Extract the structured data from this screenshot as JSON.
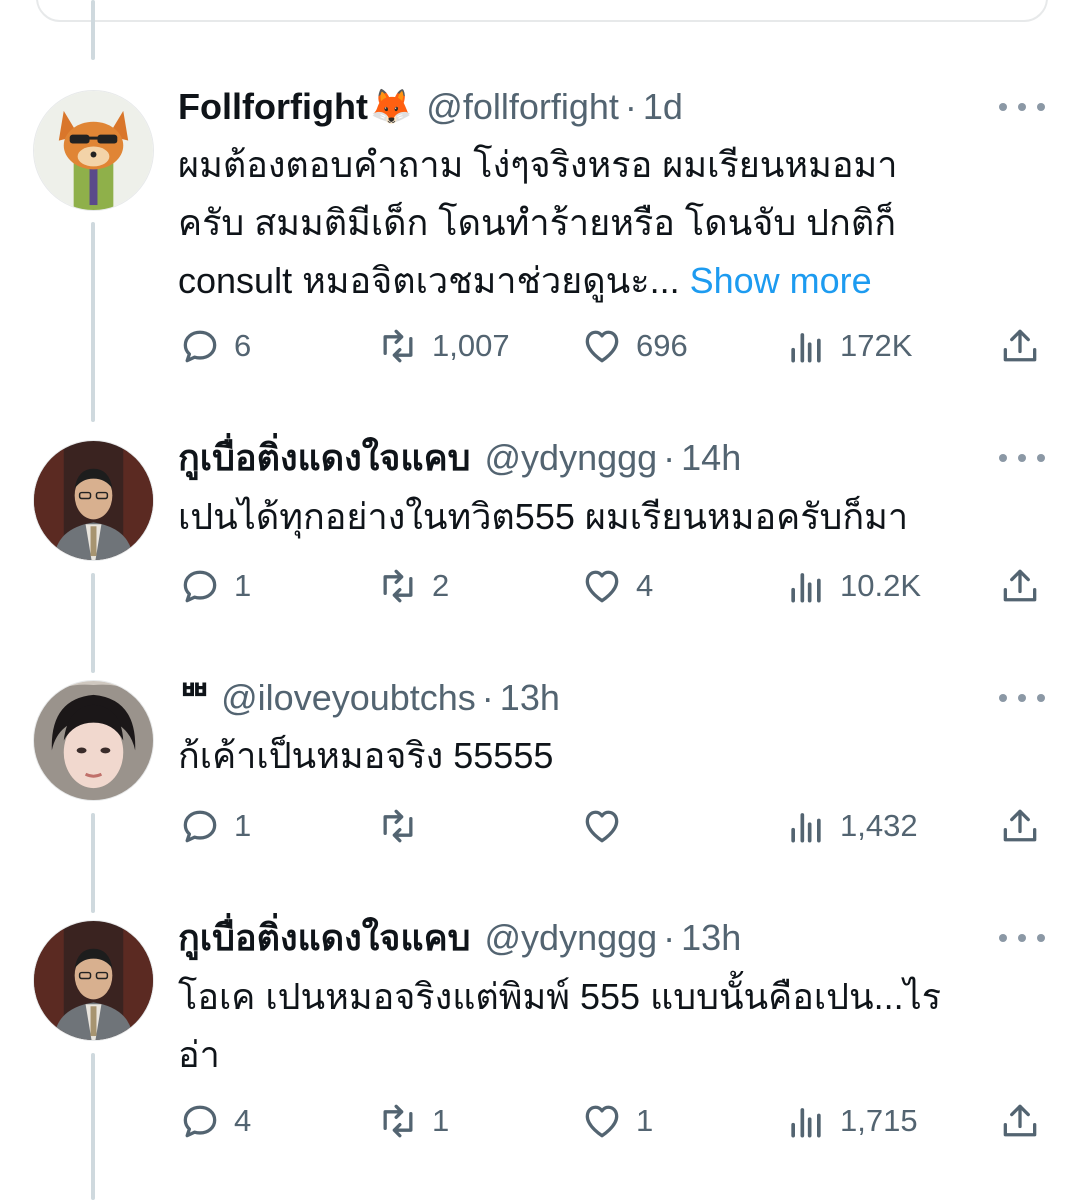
{
  "tweets": [
    {
      "name": "Follforfight",
      "name_emoji": "🦊",
      "handle": "@follforfight",
      "separator": "·",
      "time": "1d",
      "text_lines": [
        "ผมต้องตอบคำถาม โง่ๆจริงหรอ ผมเรียนหมอมา",
        "ครับ  สมมติมีเด็ก โดนทำร้ายหรือ โดนจับ ปกติก็",
        "consult หมอจิตเวชมาช่วยดูนะ..."
      ],
      "show_more": "Show more",
      "stats": {
        "replies": "6",
        "retweets": "1,007",
        "likes": "696",
        "views": "172K"
      },
      "avatar_icon": "fox-avatar"
    },
    {
      "name": "กูเบื่อติ่งแดงใจแคบ",
      "handle": "@ydynggg",
      "separator": "·",
      "time": "14h",
      "text_lines": [
        "เปนได้ทุกอย่างในทวิต555 ผมเรียนหมอครับก็มา"
      ],
      "stats": {
        "replies": "1",
        "retweets": "2",
        "likes": "4",
        "views": "10.2K"
      },
      "avatar_icon": "man-in-suit-avatar"
    },
    {
      "name": "ᄈ",
      "handle": "@iloveyoubtchs",
      "separator": "·",
      "time": "13h",
      "text_lines": [
        "ก้เค้าเป็นหมอจริง 55555"
      ],
      "stats": {
        "replies": "1",
        "retweets": "",
        "likes": "",
        "views": "1,432"
      },
      "avatar_icon": "person-face-avatar"
    },
    {
      "name": "กูเบื่อติ่งแดงใจแคบ",
      "handle": "@ydynggg",
      "separator": "·",
      "time": "13h",
      "text_lines": [
        "โอเค เปนหมอจริงแต่พิมพ์ 555 แบบนั้นคือเปน...ไร",
        "อ่า"
      ],
      "stats": {
        "replies": "4",
        "retweets": "1",
        "likes": "1",
        "views": "1,715"
      },
      "avatar_icon": "man-in-suit-avatar"
    }
  ],
  "icons": {
    "reply": "reply-icon",
    "retweet": "retweet-icon",
    "like": "heart-icon",
    "views": "views-icon",
    "share": "share-icon",
    "more": "more-icon"
  },
  "colors": {
    "text": "#0f1419",
    "secondary": "#536471",
    "link": "#1d9bf0",
    "thread_line": "#cfd9de",
    "icon": "#536471"
  }
}
